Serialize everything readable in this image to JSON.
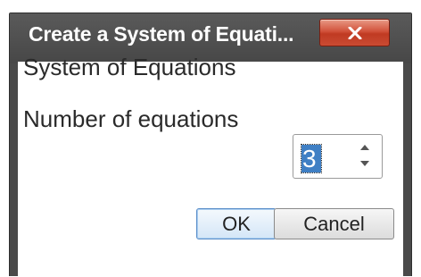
{
  "dialog": {
    "title": "Create a System of Equati...",
    "close_symbol": "✕",
    "heading": "System of Equations",
    "number_label": "Number of equations",
    "number_value": "3",
    "ok_label": "OK",
    "cancel_label": "Cancel"
  },
  "colors": {
    "titlebar": "#4a4a4a",
    "close_button": "#c9452e",
    "selection": "#3f7fc4"
  },
  "icons": {
    "close": "close-icon",
    "spin_up": "chevron-up-icon",
    "spin_down": "chevron-down-icon"
  }
}
